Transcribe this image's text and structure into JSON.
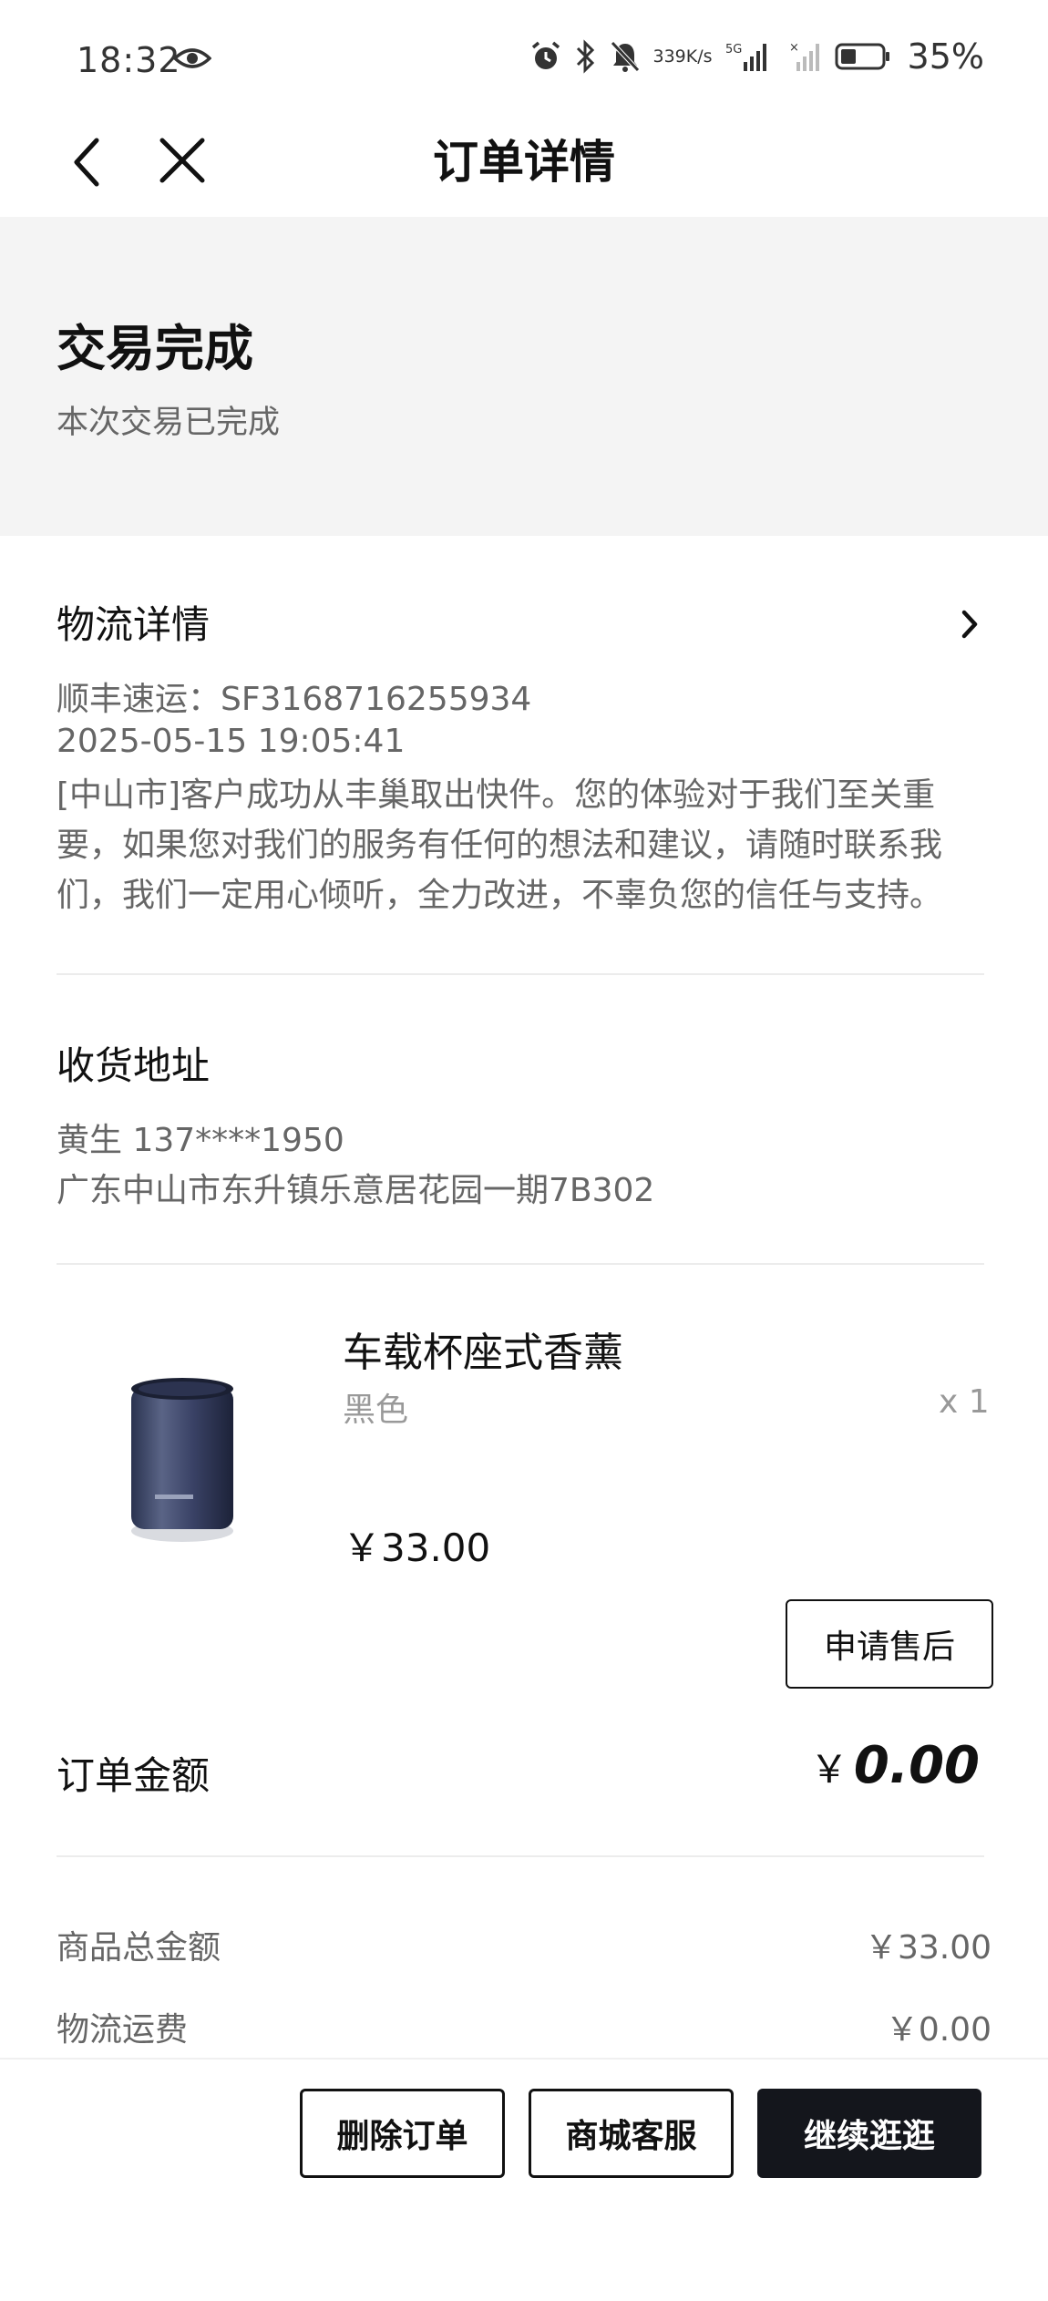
{
  "status_bar": {
    "time": "18:32",
    "net_speed_top": "339",
    "net_speed_unit": "K/s",
    "network_label": "5G",
    "battery": "35%",
    "icons": [
      "eye-icon",
      "alarm-icon",
      "bluetooth-icon",
      "mute-icon",
      "signal-icon",
      "battery-icon"
    ]
  },
  "nav": {
    "title": "订单详情",
    "back_icon": "chevron-left-icon",
    "close_icon": "close-icon"
  },
  "order_status": {
    "title": "交易完成",
    "subtitle": "本次交易已完成"
  },
  "logistics": {
    "title": "物流详情",
    "carrier_line": "顺丰速运：SF3168716255934",
    "time": "2025-05-15 19:05:41",
    "description": "[中山市]客户成功从丰巢取出快件。您的体验对于我们至关重要，如果您对我们的服务有任何的想法和建议，请随时联系我们，我们一定用心倾听，全力改进，不辜负您的信任与支持。"
  },
  "address": {
    "title": "收货地址",
    "recipient": "黄生  137****1950",
    "line": "广东中山市东升镇乐意居花园一期7B302"
  },
  "product": {
    "name": "车载杯座式香薰",
    "spec": "黑色",
    "quantity": "x 1",
    "price": "￥33.00",
    "after_sale_label": "申请售后"
  },
  "order_amount": {
    "label": "订单金额",
    "currency": "￥",
    "value": "0.00"
  },
  "summary": [
    {
      "label": "商品总金额",
      "value": "￥33.00"
    },
    {
      "label": "物流运费",
      "value": "￥0.00"
    }
  ],
  "actions": {
    "delete_label": "删除订单",
    "service_label": "商城客服",
    "continue_label": "继续逛逛"
  },
  "colors": {
    "status_bg": "#f4f4f4",
    "primary_dark": "#14161c",
    "text_secondary": "#666666"
  }
}
